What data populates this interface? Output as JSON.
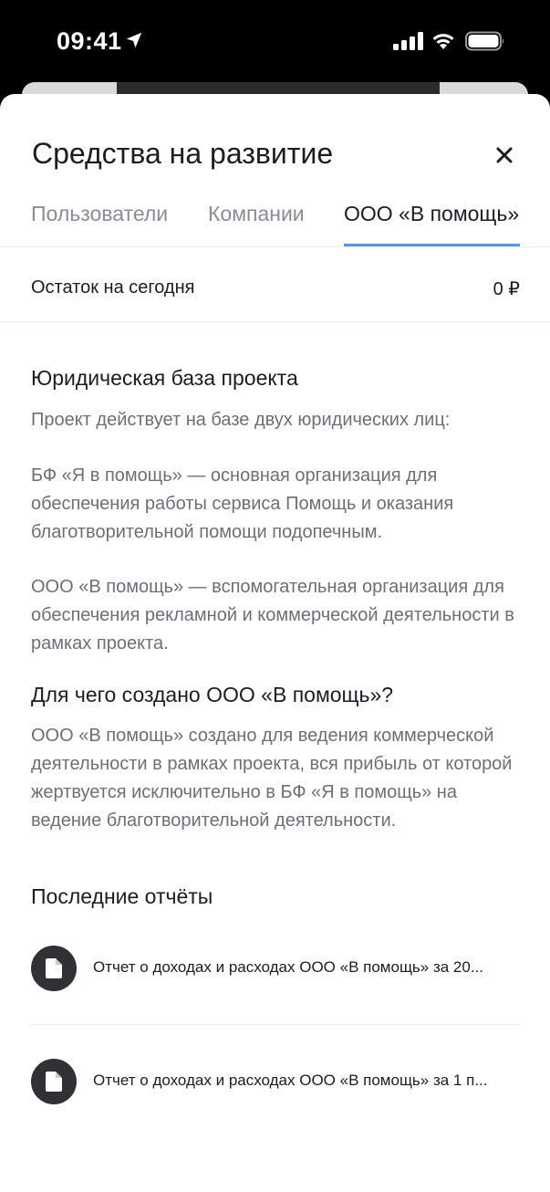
{
  "status_bar": {
    "time": "09:41",
    "icons": [
      "location-arrow-icon",
      "signal-icon",
      "wifi-icon",
      "battery-icon"
    ]
  },
  "sheet": {
    "title": "Средства на развитие",
    "close_icon": "close-icon"
  },
  "tabs": [
    {
      "label": "Пользователи",
      "active": false
    },
    {
      "label": "Компании",
      "active": false
    },
    {
      "label": "ООО «В помощь»",
      "active": true
    }
  ],
  "balance": {
    "label": "Остаток на сегодня",
    "value": "0 ₽"
  },
  "legal": {
    "heading": "Юридическая база проекта",
    "paragraphs": [
      "Проект действует на базе двух юридических лиц:",
      "БФ «Я в помощь» — основная организация для обеспечения работы сервиса Помощь и оказания благотворительной помощи подопечным.",
      "ООО «В помощь» — вспомогательная организация для обеспечения рекламной и коммерческой деятельности в рамках проекта."
    ]
  },
  "purpose": {
    "heading": "Для чего создано ООО «В помощь»?",
    "text": "ООО «В помощь» создано для ведения коммерческой деятельности в рамках проекта, вся прибыль от которой жертвуется исключительно в БФ «Я в помощь»  на ведение благотворительной деятельности."
  },
  "reports": {
    "heading": "Последние отчёты",
    "items": [
      {
        "label": "Отчет о доходах и расходах ООО «В помощь» за 20...",
        "icon": "document-icon"
      },
      {
        "label": "Отчет о доходах и расходах ООО «В помощь» за 1 п...",
        "icon": "document-icon"
      }
    ]
  },
  "colors": {
    "accent": "#5b98d8",
    "text_primary": "#1c1d22",
    "text_secondary": "#6d6f76",
    "icon_bg": "#2f3135"
  }
}
